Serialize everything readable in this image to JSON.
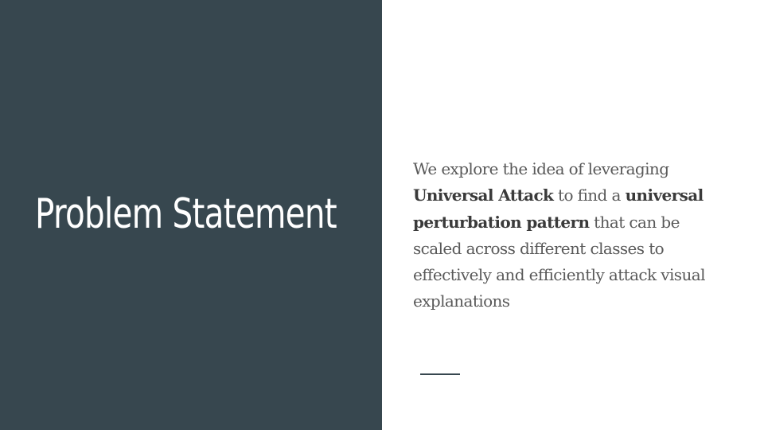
{
  "slide": {
    "title": "Problem Statement",
    "body": {
      "seg1": "We explore the idea of leveraging ",
      "bold1": "Universal Attack",
      "seg2": " to find a ",
      "bold2": "universal perturbation pattern",
      "seg3": " that can be scaled across different classes to effectively and efficiently attack visual explanations"
    }
  },
  "colors": {
    "left_panel_bg": "#37474f",
    "title_text": "#ffffff",
    "body_text": "#595959",
    "accent_line": "#37474f"
  }
}
